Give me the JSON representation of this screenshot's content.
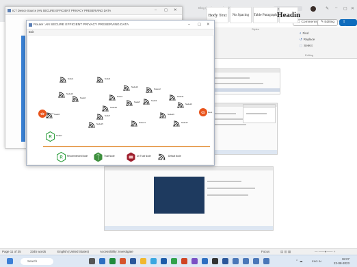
{
  "word": {
    "doc_title_ghost": "Blog (111) - Saved to this PC",
    "search_ghost": "Search",
    "ribbon_buttons": {
      "comments": "Comments",
      "editing": "Editing",
      "share": "Share"
    },
    "styles": [
      {
        "label": "Body Text",
        "size": "6.5px"
      },
      {
        "label": "No Spacing",
        "size": "5.2px"
      },
      {
        "label": "Table Paragraph",
        "size": "5.2px"
      },
      {
        "label": "Headin",
        "size": "11px"
      }
    ],
    "styles_group": "Styles",
    "editing_items": [
      {
        "icon": "⌕",
        "label": "Find"
      },
      {
        "icon": "↺",
        "label": "Replace"
      },
      {
        "icon": "⬚",
        "label": "Select"
      }
    ],
    "editing_group": "Editing",
    "status": {
      "page": "Page 11 of 35",
      "words": "3345 words",
      "language": "English (United States)",
      "accessibility": "Accessibility: Investigate",
      "focus": "Focus"
    },
    "taskbar": {
      "search": "Search",
      "time": "18:27",
      "date": "22-08-2023",
      "weather": "ENG IN"
    }
  },
  "outer_window": {
    "title": "ICT Device Source (AN SECURE EFFICIENT PRIVACY PRESERVING DATA"
  },
  "router_window": {
    "title": "Router :AN SECURE EFFICIENT PRIVACY PRESERVING DATA",
    "menu": "Exit",
    "source": "Source",
    "destination": "Dest",
    "nodes": [
      "Node1",
      "Node2",
      "Node3",
      "Node4",
      "Node5",
      "Node6",
      "Node7",
      "Node8",
      "Node9",
      "Node10",
      "Node11",
      "Node12",
      "Node13",
      "Node14",
      "Node15",
      "Node16",
      "Node17",
      "Node18",
      "Node19"
    ],
    "legend": {
      "recommended": "Recommended Node",
      "trust": "Trust Node",
      "un_trust": "Un Trust Node",
      "default": "Default Node"
    },
    "r_glyph": "R"
  },
  "colors": {
    "hub": "#e8541c",
    "recommended": "#2e9e3e",
    "trust": "#3e8f3e",
    "untrust": "#9e1f2e",
    "accent_line": "#e8a35c",
    "blue_strip": "#3b82d4"
  }
}
